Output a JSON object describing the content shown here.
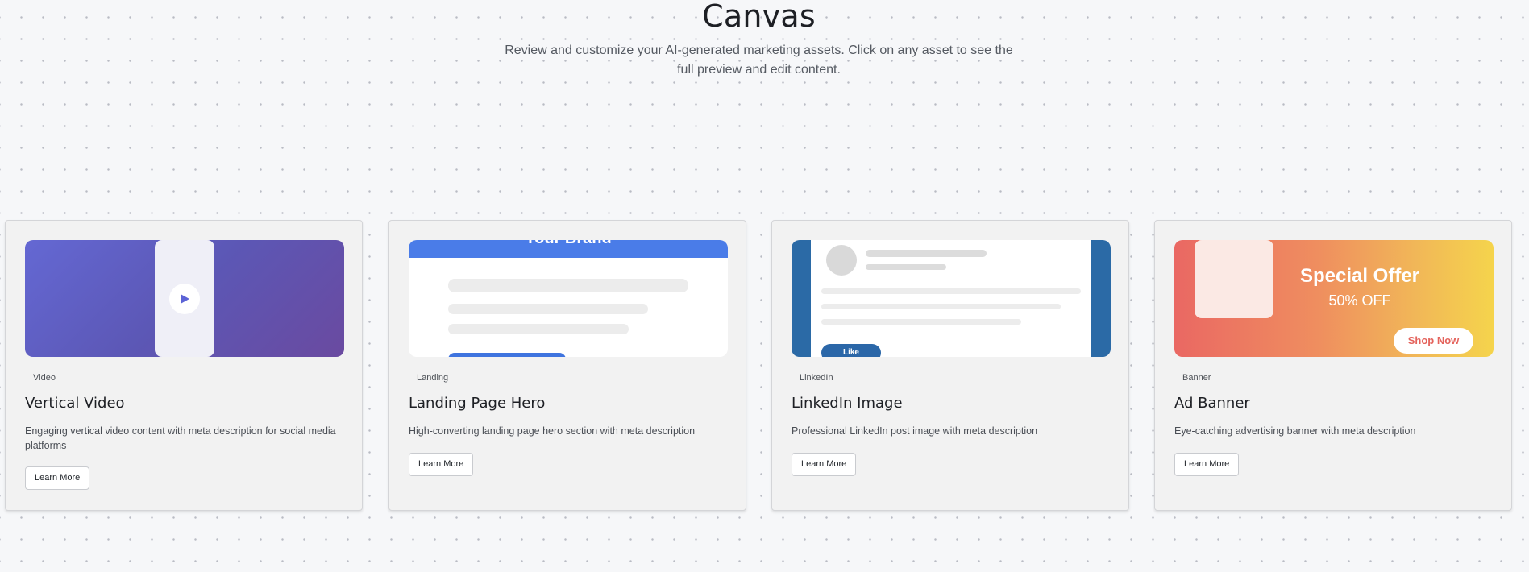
{
  "header": {
    "title": "Canvas",
    "subtitle": "Review and customize your AI-generated marketing assets. Click on any asset to see the full preview and edit content."
  },
  "cards": [
    {
      "tag": "Video",
      "title": "Vertical Video",
      "description": "Engaging vertical video content with meta description for social media platforms",
      "button": "Learn More",
      "preview_icon": "play-icon"
    },
    {
      "tag": "Landing",
      "title": "Landing Page Hero",
      "description": "High-converting landing page hero section with meta description",
      "button": "Learn More",
      "preview_text": "Your Brand"
    },
    {
      "tag": "LinkedIn",
      "title": "LinkedIn Image",
      "description": "Professional LinkedIn post image with meta description",
      "button": "Learn More",
      "preview_button": "Like"
    },
    {
      "tag": "Banner",
      "title": "Ad Banner",
      "description": "Eye-catching advertising banner with meta description",
      "button": "Learn More",
      "preview_headline": "Special Offer",
      "preview_discount": "50% OFF",
      "preview_cta": "Shop Now"
    }
  ],
  "colors": {
    "video_gradient": [
      "#6468d3",
      "#6a4aa0"
    ],
    "landing_accent": "#4a7ce8",
    "linkedin_blue": "#2b6aa6",
    "banner_gradient": [
      "#ea6863",
      "#f5d44c"
    ],
    "shop_now_text": "#e4635c"
  }
}
